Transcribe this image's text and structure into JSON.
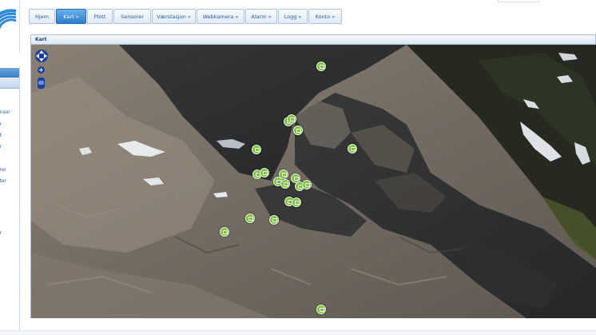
{
  "nav": {
    "tabs": [
      {
        "label": "Hjem",
        "active": false
      },
      {
        "label": "Kart »",
        "active": true
      },
      {
        "label": "Plott",
        "active": false
      },
      {
        "label": "Sensorer",
        "active": false
      },
      {
        "label": "Værstasjon »",
        "active": false
      },
      {
        "label": "Webkamera »",
        "active": false
      },
      {
        "label": "Alarm »",
        "active": false
      },
      {
        "label": "Logg »",
        "active": false
      },
      {
        "label": "Konto »",
        "active": false
      }
    ]
  },
  "sidebar": {
    "items": [
      {
        "label": "ensor"
      },
      {
        "label": "er"
      },
      {
        "label": "et"
      },
      {
        "label": "er"
      },
      {
        "label": "orer"
      },
      {
        "label": "eter"
      },
      {
        "label": "er"
      },
      {
        "label": "A"
      }
    ]
  },
  "panel": {
    "title": "Kart"
  },
  "map": {
    "zoom_in_label": "+",
    "zoom_out_label": "−",
    "marker_icon": "sensor-marker-icon",
    "marker_color": "#7ec443"
  },
  "colors": {
    "accent": "#2c7cc9",
    "tab_text": "#1f5ca8"
  }
}
